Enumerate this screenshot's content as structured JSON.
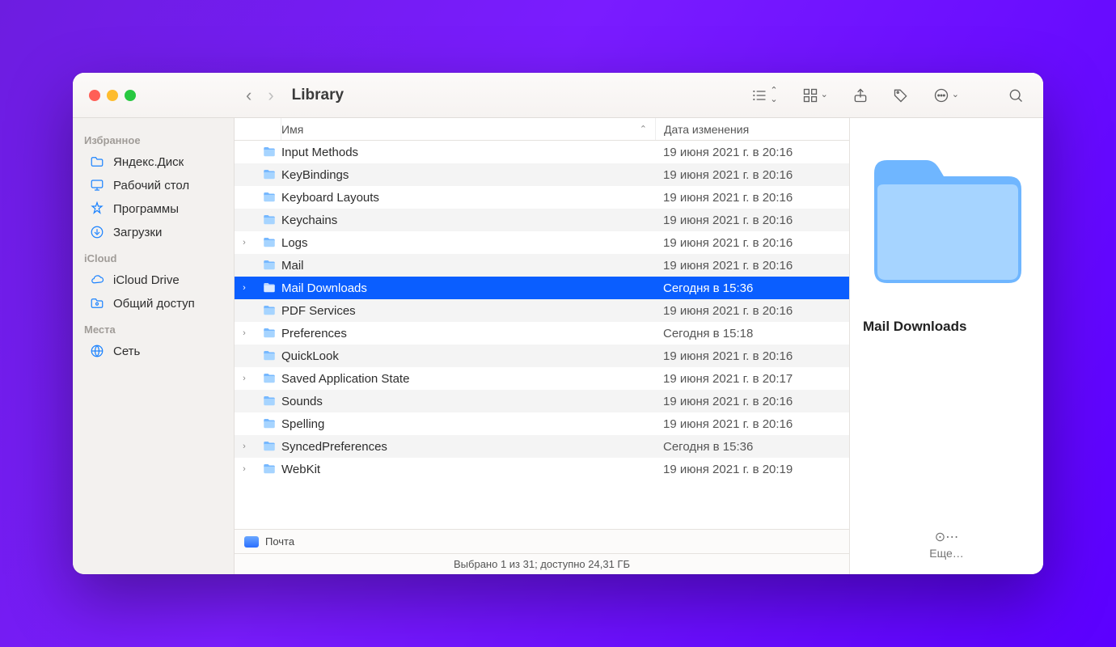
{
  "window_title": "Library",
  "sidebar": {
    "sections": [
      {
        "header": "Избранное",
        "items": [
          {
            "icon": "folder",
            "label": "Яндекс.Диск"
          },
          {
            "icon": "desktop",
            "label": "Рабочий стол"
          },
          {
            "icon": "apps",
            "label": "Программы"
          },
          {
            "icon": "download",
            "label": "Загрузки"
          }
        ]
      },
      {
        "header": "iCloud",
        "items": [
          {
            "icon": "cloud",
            "label": "iCloud Drive"
          },
          {
            "icon": "share",
            "label": "Общий доступ"
          }
        ]
      },
      {
        "header": "Места",
        "items": [
          {
            "icon": "globe",
            "label": "Сеть"
          }
        ]
      }
    ]
  },
  "columns": {
    "name": "Имя",
    "modified": "Дата изменения"
  },
  "files": [
    {
      "name": "Input Methods",
      "date": "19 июня 2021 г. в 20:16",
      "disc": false,
      "sel": false
    },
    {
      "name": "KeyBindings",
      "date": "19 июня 2021 г. в 20:16",
      "disc": false,
      "sel": false
    },
    {
      "name": "Keyboard Layouts",
      "date": "19 июня 2021 г. в 20:16",
      "disc": false,
      "sel": false
    },
    {
      "name": "Keychains",
      "date": "19 июня 2021 г. в 20:16",
      "disc": false,
      "sel": false
    },
    {
      "name": "Logs",
      "date": "19 июня 2021 г. в 20:16",
      "disc": true,
      "sel": false
    },
    {
      "name": "Mail",
      "date": "19 июня 2021 г. в 20:16",
      "disc": false,
      "sel": false
    },
    {
      "name": "Mail Downloads",
      "date": "Сегодня в 15:36",
      "disc": true,
      "sel": true
    },
    {
      "name": "PDF Services",
      "date": "19 июня 2021 г. в 20:16",
      "disc": false,
      "sel": false
    },
    {
      "name": "Preferences",
      "date": "Сегодня в 15:18",
      "disc": true,
      "sel": false
    },
    {
      "name": "QuickLook",
      "date": "19 июня 2021 г. в 20:16",
      "disc": false,
      "sel": false
    },
    {
      "name": "Saved Application State",
      "date": "19 июня 2021 г. в 20:17",
      "disc": true,
      "sel": false
    },
    {
      "name": "Sounds",
      "date": "19 июня 2021 г. в 20:16",
      "disc": false,
      "sel": false
    },
    {
      "name": "Spelling",
      "date": "19 июня 2021 г. в 20:16",
      "disc": false,
      "sel": false
    },
    {
      "name": "SyncedPreferences",
      "date": "Сегодня в 15:36",
      "disc": true,
      "sel": false
    },
    {
      "name": "WebKit",
      "date": "19 июня 2021 г. в 20:19",
      "disc": true,
      "sel": false
    }
  ],
  "preview": {
    "name": "Mail Downloads",
    "more": "Еще…"
  },
  "tagbar": {
    "label": "Почта"
  },
  "statusbar": "Выбрано 1 из 31; доступно 24,31 ГБ"
}
